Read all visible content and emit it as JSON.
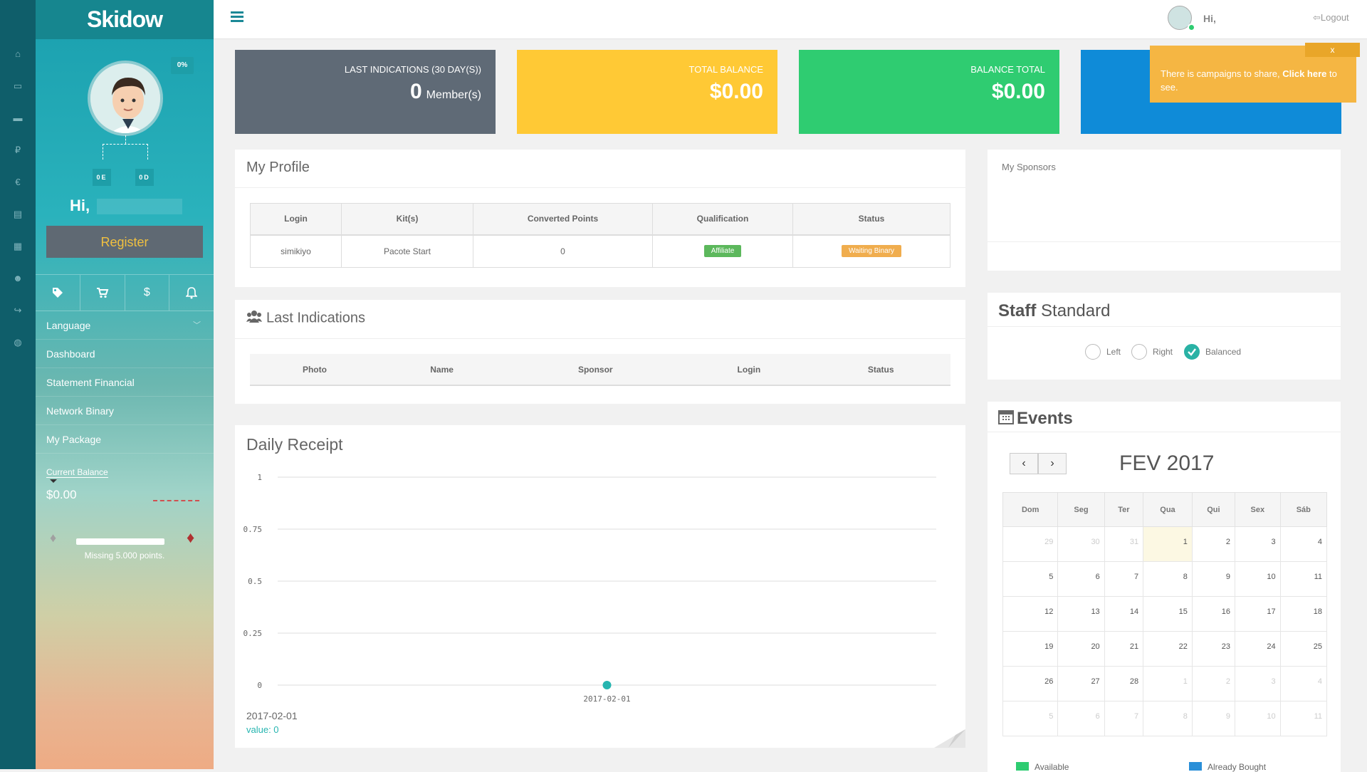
{
  "brand": "Skidow",
  "sidebar": {
    "percent": "0%",
    "tree_left": "0E",
    "tree_right": "0D",
    "greeting": "Hi,",
    "register_label": "Register",
    "menu": [
      "Language",
      "Dashboard",
      "Statement Financial",
      "Network Binary",
      "My Package"
    ],
    "current_balance_label": "Current Balance",
    "current_balance_value": "$0.00",
    "progress": 0,
    "missing_points": "Missing 5.000 points."
  },
  "topbar": {
    "greeting": "Hi,",
    "logout": "Logout"
  },
  "tiles": {
    "last_indications_label": "LAST INDICATIONS (30 DAY(S))",
    "last_indications_value": "0",
    "last_indications_unit": "Member(s)",
    "total_balance_label": "TOTAL BALANCE",
    "total_balance_value": "$0.00",
    "balance_total_label": "BALANCE TOTAL",
    "balance_total_value": "$0.00"
  },
  "toast": {
    "text": "There is campaigns to share, ",
    "link": "Click here",
    "tail": " to see.",
    "close": "x"
  },
  "profile": {
    "title": "My Profile",
    "headers": [
      "Login",
      "Kit(s)",
      "Converted Points",
      "Qualification",
      "Status"
    ],
    "row": {
      "login": "simikiyo",
      "kit": "Pacote Start",
      "points": "0",
      "qualification": "Affiliate",
      "status": "Waiting Binary"
    }
  },
  "last_indications": {
    "title": "Last Indications",
    "headers": [
      "Photo",
      "Name",
      "Sponsor",
      "Login",
      "Status"
    ]
  },
  "daily": {
    "title": "Daily Receipt",
    "tooltip_date": "2017-02-01",
    "tooltip_value": "value: 0",
    "chart_data": {
      "type": "line",
      "x": [
        "2017-02-01"
      ],
      "values": [
        0
      ],
      "ylim": [
        0,
        1
      ],
      "yticks": [
        "1",
        "0.75",
        "0.5",
        "0.25",
        "0"
      ],
      "xticks": [
        "2017-02-01"
      ],
      "grid": true,
      "color": "#26b5b0"
    }
  },
  "sponsors": {
    "title": "My Sponsors"
  },
  "staff": {
    "title_bold": "Staff",
    "title_rest": "Standard",
    "options": [
      "Left",
      "Right",
      "Balanced"
    ],
    "selected": "Balanced"
  },
  "events": {
    "title": "Events",
    "month": "FEV 2017",
    "days": [
      "Dom",
      "Seg",
      "Ter",
      "Qua",
      "Qui",
      "Sex",
      "Sáb"
    ],
    "weeks": [
      [
        "29",
        "30",
        "31",
        "1",
        "2",
        "3",
        "4"
      ],
      [
        "5",
        "6",
        "7",
        "8",
        "9",
        "10",
        "11"
      ],
      [
        "12",
        "13",
        "14",
        "15",
        "16",
        "17",
        "18"
      ],
      [
        "19",
        "20",
        "21",
        "22",
        "23",
        "24",
        "25"
      ],
      [
        "26",
        "27",
        "28",
        "1",
        "2",
        "3",
        "4"
      ],
      [
        "5",
        "6",
        "7",
        "8",
        "9",
        "10",
        "11"
      ]
    ],
    "legend": [
      "Available",
      "Already Bought"
    ]
  }
}
